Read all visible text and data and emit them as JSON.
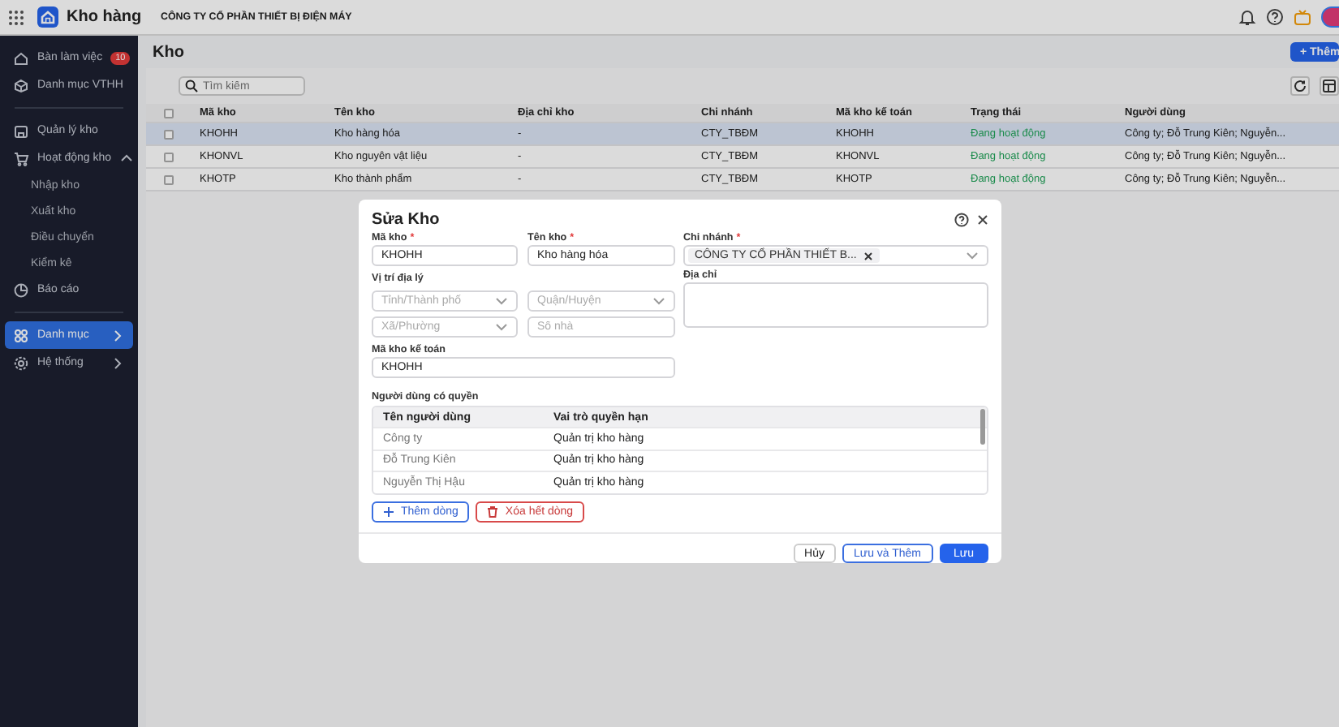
{
  "app": {
    "title": "Kho hàng",
    "company": "CÔNG TY CỔ PHẦN THIẾT BỊ ĐIỆN MÁY"
  },
  "sidebar": {
    "items": [
      {
        "label": "Bàn làm việc",
        "badge": "10",
        "selected": false
      },
      {
        "label": "Danh mục VTHH",
        "selected": false
      },
      {
        "kind": "divider"
      },
      {
        "label": "Quản lý kho",
        "selected": false
      },
      {
        "label": "Hoạt động kho",
        "selected": false,
        "expanded": true,
        "children": [
          {
            "label": "Nhập kho",
            "selected": false
          },
          {
            "label": "Xuất kho",
            "selected": false
          },
          {
            "label": "Điều chuyển",
            "selected": false
          },
          {
            "label": "Kiểm kê",
            "selected": false
          }
        ]
      },
      {
        "label": "Báo cáo",
        "selected": false
      },
      {
        "kind": "divider"
      },
      {
        "label": "Danh mục",
        "selected": true,
        "expanded": false
      },
      {
        "label": "Hệ thống",
        "selected": false,
        "expanded": false
      }
    ]
  },
  "page": {
    "title": "Kho",
    "add_button": "+ Thêm",
    "search": {
      "placeholder": "Tìm kiếm"
    }
  },
  "table": {
    "all_checked": false,
    "columns": [
      "Mã kho",
      "Tên kho",
      "Địa chỉ kho",
      "Chi nhánh",
      "Mã kho kế toán",
      "Trạng thái",
      "Người dùng"
    ],
    "rows": [
      {
        "selected": true,
        "checked": false,
        "cells": [
          "KHOHH",
          "Kho hàng hóa",
          "-",
          "CTY_TBĐM",
          "KHOHH",
          "Đang hoạt động",
          "Công ty; Đỗ Trung Kiên; Nguyễn..."
        ]
      },
      {
        "selected": false,
        "checked": false,
        "cells": [
          "KHONVL",
          "Kho nguyên vật liệu",
          "-",
          "CTY_TBĐM",
          "KHONVL",
          "Đang hoạt động",
          "Công ty; Đỗ Trung Kiên; Nguyễn..."
        ]
      },
      {
        "selected": false,
        "checked": false,
        "cells": [
          "KHOTP",
          "Kho thành phẩm",
          "-",
          "CTY_TBĐM",
          "KHOTP",
          "Đang hoạt động",
          "Công ty; Đỗ Trung Kiên; Nguyễn..."
        ]
      }
    ]
  },
  "dialog": {
    "title": "Sửa Kho",
    "required_mark": "*",
    "ma_kho": {
      "label": "Mã kho",
      "required": true,
      "value": "KHOHH"
    },
    "ten_kho": {
      "label": "Tên kho",
      "required": true,
      "value": "Kho hàng hóa"
    },
    "vi_tri": {
      "label": "Vị trí địa lý",
      "province": {
        "placeholder": "Tỉnh/Thành phố"
      },
      "district": {
        "placeholder": "Quận/Huyện"
      },
      "ward": {
        "placeholder": "Xã/Phường"
      },
      "house": {
        "placeholder": "Số nhà"
      }
    },
    "ma_kho_ke_toan": {
      "label": "Mã kho kế toán",
      "value": "KHOHH"
    },
    "chi_nhanh": {
      "label": "Chi nhánh",
      "required": true,
      "tag": "CÔNG TY CỔ PHẦN THIẾT B..."
    },
    "dia_chi": {
      "label": "Địa chỉ"
    },
    "users": {
      "label": "Người dùng có quyền",
      "columns": [
        "Tên người dùng",
        "Vai trò quyền hạn"
      ],
      "rows": [
        [
          "Công ty",
          "Quản trị kho hàng"
        ],
        [
          "Đỗ Trung Kiên",
          "Quản trị kho hàng"
        ],
        [
          "Nguyễn Thị Hậu",
          "Quản trị kho hàng"
        ]
      ]
    },
    "add_row": "Thêm dòng",
    "delete_all": "Xóa hết dòng",
    "buttons": [
      {
        "label": "Hủy",
        "kind": "plain"
      },
      {
        "label": "Lưu và Thêm",
        "kind": "outline"
      },
      {
        "label": "Lưu",
        "kind": "primary"
      }
    ]
  }
}
